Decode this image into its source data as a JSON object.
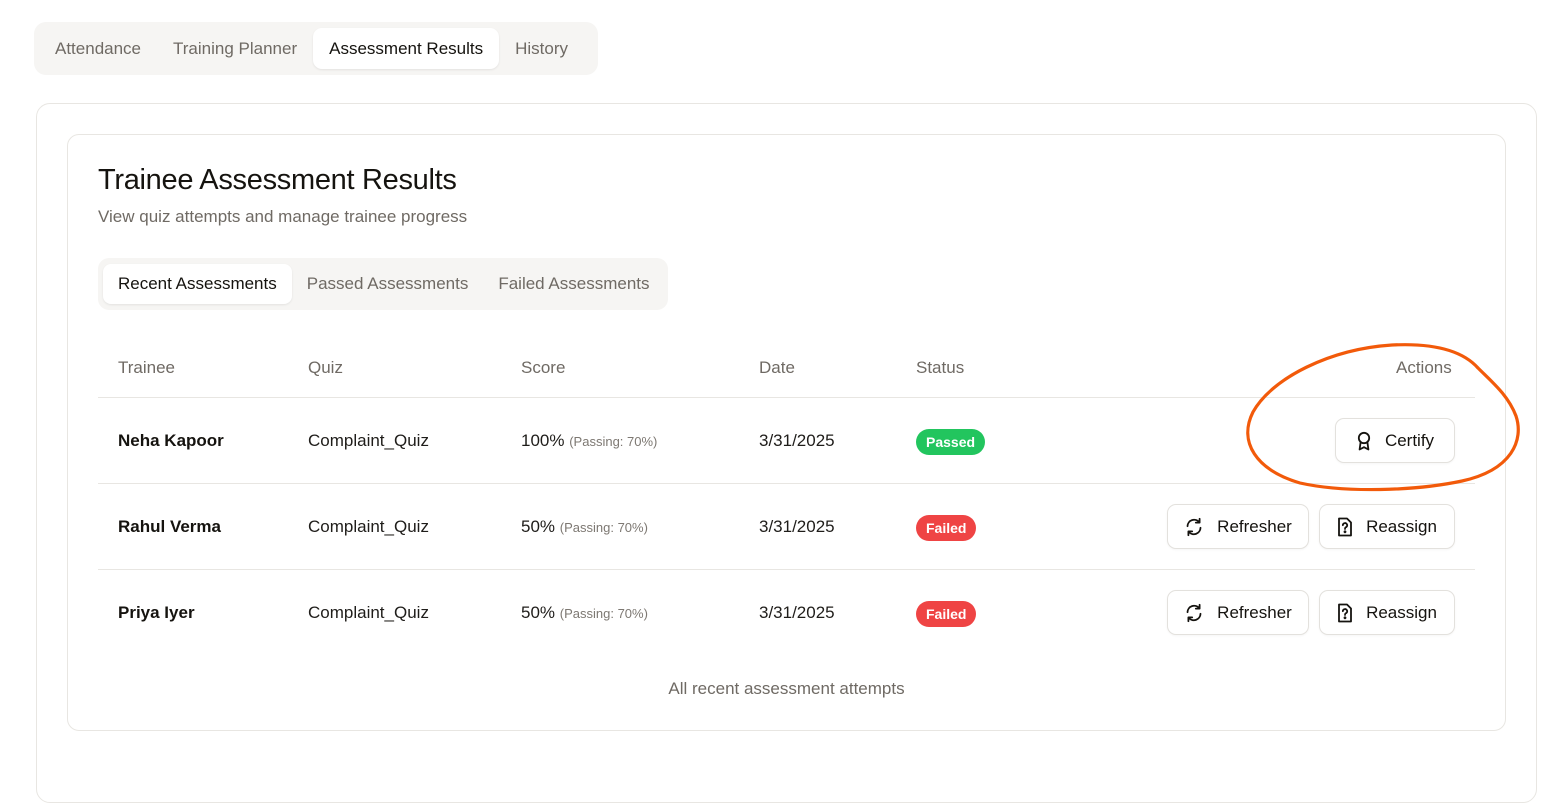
{
  "top_tabs": [
    {
      "label": "Attendance",
      "active": false
    },
    {
      "label": "Training Planner",
      "active": false
    },
    {
      "label": "Assessment Results",
      "active": true
    },
    {
      "label": "History",
      "active": false
    }
  ],
  "card": {
    "title": "Trainee Assessment Results",
    "subtitle": "View quiz attempts and manage trainee progress"
  },
  "sub_tabs": [
    {
      "label": "Recent Assessments",
      "active": true
    },
    {
      "label": "Passed Assessments",
      "active": false
    },
    {
      "label": "Failed Assessments",
      "active": false
    }
  ],
  "table": {
    "headers": {
      "trainee": "Trainee",
      "quiz": "Quiz",
      "score": "Score",
      "date": "Date",
      "status": "Status",
      "actions": "Actions"
    },
    "rows": [
      {
        "trainee": "Neha Kapoor",
        "quiz": "Complaint_Quiz",
        "score": "100%",
        "passing": "(Passing: 70%)",
        "date": "3/31/2025",
        "status": "Passed",
        "actions": {
          "certify": "Certify"
        }
      },
      {
        "trainee": "Rahul Verma",
        "quiz": "Complaint_Quiz",
        "score": "50%",
        "passing": "(Passing: 70%)",
        "date": "3/31/2025",
        "status": "Failed",
        "actions": {
          "refresher": "Refresher",
          "reassign": "Reassign"
        }
      },
      {
        "trainee": "Priya Iyer",
        "quiz": "Complaint_Quiz",
        "score": "50%",
        "passing": "(Passing: 70%)",
        "date": "3/31/2025",
        "status": "Failed",
        "actions": {
          "refresher": "Refresher",
          "reassign": "Reassign"
        }
      }
    ]
  },
  "footer_note": "All recent assessment attempts",
  "colors": {
    "passed_badge": "#22c55e",
    "failed_badge": "#ef4444",
    "annotation_stroke": "#f25a0a"
  },
  "icons": {
    "certify": "award-icon",
    "refresher": "refresh-icon",
    "reassign": "file-question-icon"
  }
}
